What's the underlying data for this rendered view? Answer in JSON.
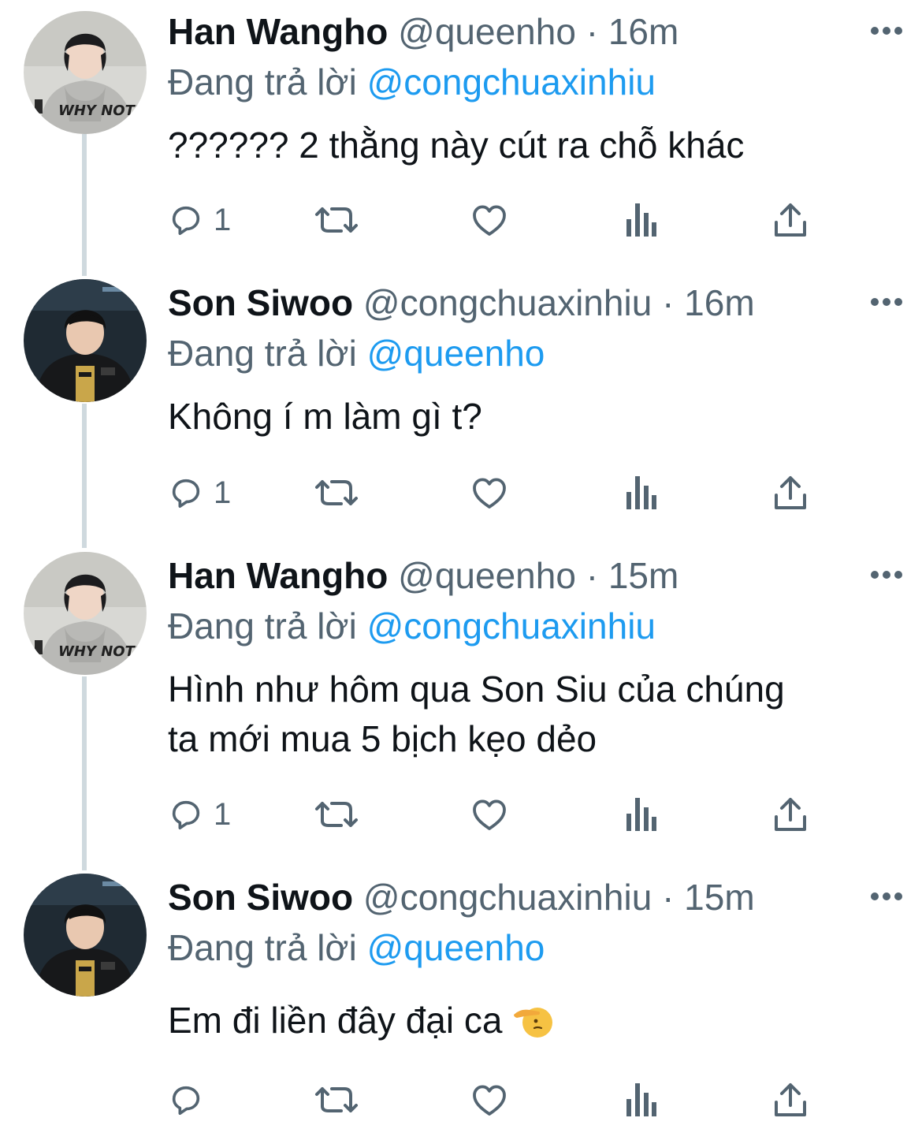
{
  "tweets": [
    {
      "name": "Han Wangho",
      "handle": "@queenho",
      "separator": "·",
      "time": "16m",
      "reply_prefix": "Đang trả lời",
      "reply_to": "@congchuaxinhiu",
      "text_lines": [
        "?????? 2 thằng này cút ra chỗ khác"
      ],
      "reply_count": "1",
      "avatar_icon": "avatar-hoodie-photo"
    },
    {
      "name": "Son Siwoo",
      "handle": "@congchuaxinhiu",
      "separator": "·",
      "time": "16m",
      "reply_prefix": "Đang trả lời",
      "reply_to": "@queenho",
      "text_lines": [
        "Không í m làm gì t?"
      ],
      "reply_count": "1",
      "avatar_icon": "avatar-jersey-photo"
    },
    {
      "name": "Han Wangho",
      "handle": "@queenho",
      "separator": "·",
      "time": "15m",
      "reply_prefix": "Đang trả lời",
      "reply_to": "@congchuaxinhiu",
      "text_lines": [
        "Hình như hôm qua Son Siu của chúng",
        "ta mới mua 5 bịch kẹo dẻo"
      ],
      "reply_count": "1",
      "avatar_icon": "avatar-hoodie-photo"
    },
    {
      "name": "Son Siwoo",
      "handle": "@congchuaxinhiu",
      "separator": "·",
      "time": "15m",
      "reply_prefix": "Đang trả lời",
      "reply_to": "@queenho",
      "text_lines": [
        "Em đi liền đây đại ca"
      ],
      "reply_count": "",
      "avatar_icon": "avatar-jersey-photo",
      "emoji_icon": "saluting-face-icon"
    }
  ],
  "avatar_art": {
    "hoodie_text": "WHY NOT?!"
  },
  "colors": {
    "text": "#0f1419",
    "secondary": "#536471",
    "link": "#1d9bf0",
    "thread_line": "#cfd9de",
    "background": "#ffffff"
  }
}
